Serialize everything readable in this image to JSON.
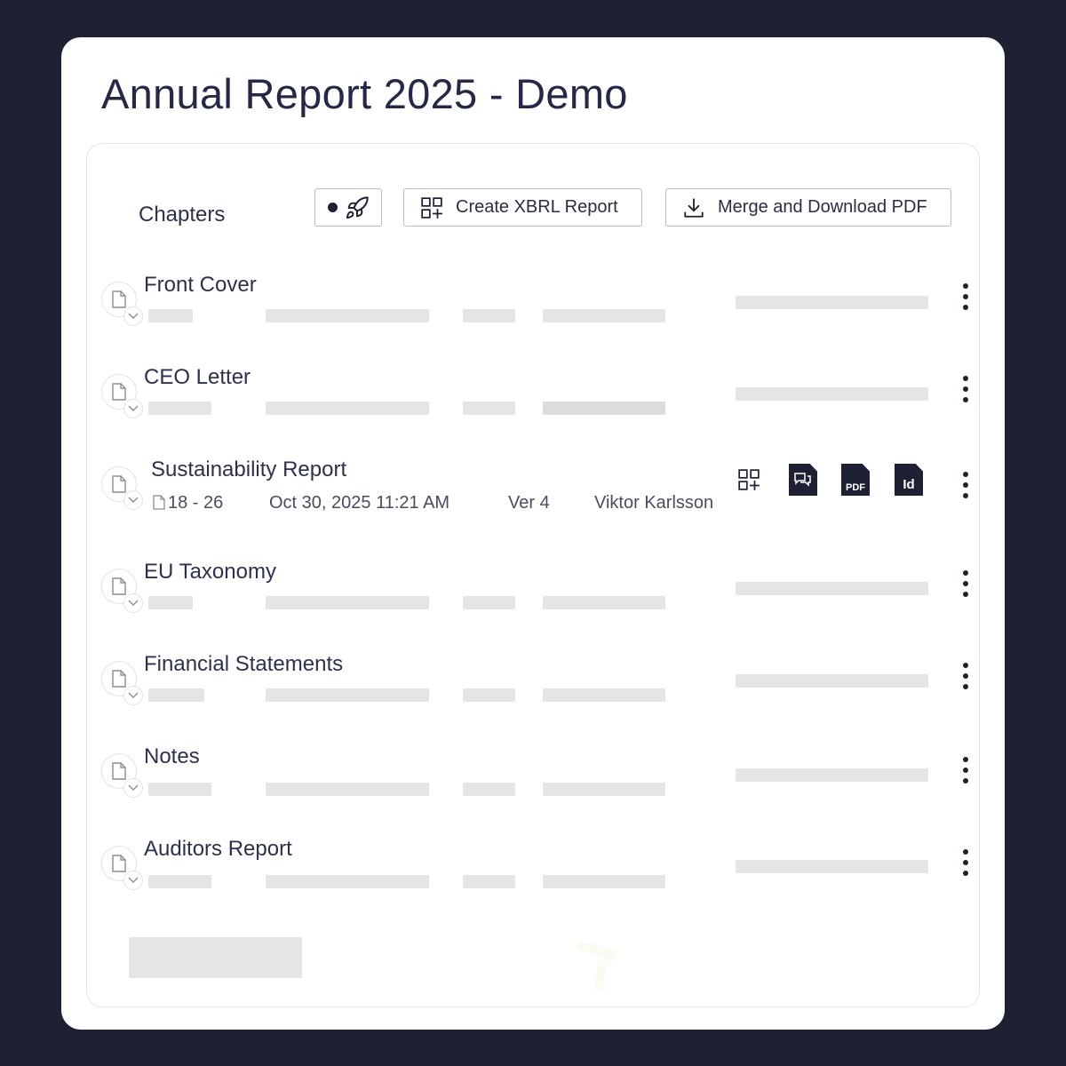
{
  "page": {
    "title": "Annual Report 2025 - Demo"
  },
  "toolbar": {
    "chapters_label": "Chapters",
    "launch_icon": "rocket-icon",
    "xbrl_label": "Create XBRL Report",
    "xbrl_icon": "grid-plus-icon",
    "pdf_label": "Merge and Download PDF",
    "pdf_icon": "download-icon"
  },
  "chapters": [
    {
      "title": "Front Cover",
      "state": "loading"
    },
    {
      "title": "CEO Letter",
      "state": "loading"
    },
    {
      "title": "Sustainability Report",
      "state": "loaded",
      "pages": "18 - 26",
      "date": "Oct 30, 2025 11:21 AM",
      "version": "Ver 4",
      "author": "Viktor Karlsson",
      "actions": [
        {
          "icon": "grid-plus-icon"
        },
        {
          "icon": "comments-file-icon"
        },
        {
          "icon": "pdf-file-icon",
          "label": "PDF"
        },
        {
          "icon": "indesign-file-icon",
          "label": "Id"
        }
      ]
    },
    {
      "title": "EU Taxonomy",
      "state": "loading"
    },
    {
      "title": "Financial Statements",
      "state": "loading"
    },
    {
      "title": "Notes",
      "state": "loading"
    },
    {
      "title": "Auditors Report",
      "state": "loading"
    }
  ],
  "colors": {
    "background": "#1e2033",
    "card": "#ffffff",
    "text": "#2b2d45",
    "skeleton": "#e5e5e5"
  }
}
